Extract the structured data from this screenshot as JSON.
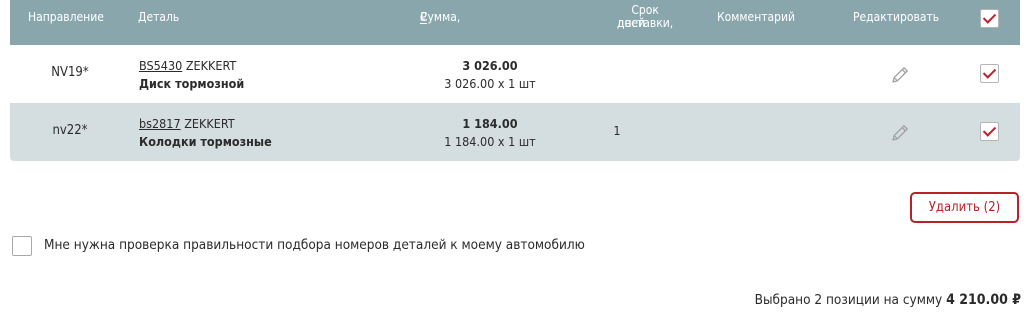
{
  "header": {
    "direction": "Направление",
    "detail": "Деталь",
    "sum": "Сумма,",
    "currency": "₽",
    "term_line1": "Срок доставки,",
    "term_line2": "дней",
    "comment": "Комментарий",
    "edit": "Редактировать",
    "select_all_checked": true
  },
  "rows": [
    {
      "direction": "NV19*",
      "article": "BS5430",
      "brand": "ZEKKERT",
      "name": "Диск тормозной",
      "sum_total": "3 026.00",
      "sum_detail": "3 026.00 x 1 шт",
      "term": "",
      "comment": "",
      "checked": true
    },
    {
      "direction": "nv22*",
      "article": "bs2817",
      "brand": "ZEKKERT",
      "name": "Колодки тормозные",
      "sum_total": "1 184.00",
      "sum_detail": "1 184.00 x 1 шт",
      "term": "1",
      "comment": "",
      "checked": true
    }
  ],
  "delete_button": "Удалить (2)",
  "verify_checkbox": {
    "label": "Мне нужна проверка правильности подбора номеров деталей к моему автомобилю",
    "checked": false
  },
  "summary": {
    "text": "Выбрано 2 позиции на сумму",
    "amount": "4 210.00 ₽"
  },
  "colors": {
    "header_bg": "#8aa6ad",
    "alt_row_bg": "#d4dde0",
    "accent_red": "#b9212c"
  },
  "icons": {
    "edit": "pencil-icon",
    "check": "checkmark-icon"
  }
}
